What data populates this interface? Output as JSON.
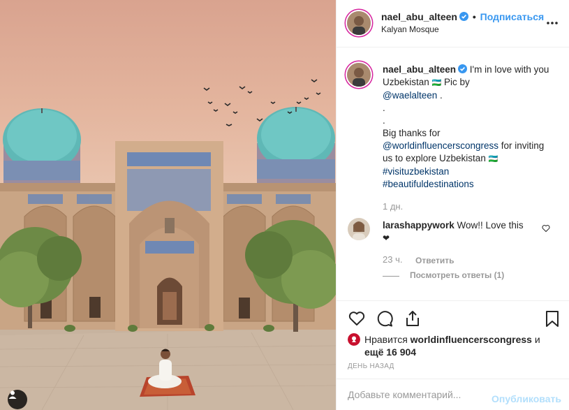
{
  "header": {
    "username": "nael_abu_alteen",
    "separator": "•",
    "follow_label": "Подписаться",
    "location": "Kalyan Mosque"
  },
  "caption": {
    "username": "nael_abu_alteen",
    "line1": " I'm in love with you Uzbekistan ",
    "line1_tail": " Pic by",
    "mention": "@waelalteen",
    "after_mention": " .",
    "dot1": ".",
    "dot2": ".",
    "thanks": "Big thanks for",
    "mention2": "@worldinfluencerscongress",
    "for_text": " for inviting us to explore Uzbekistan ",
    "hashtag1": "#visituzbekistan",
    "hashtag2": "#beautifuldestinations",
    "time": "1 дн."
  },
  "comment": {
    "username": "larashappywork",
    "text": " Wow!! Love this",
    "time": "23 ч.",
    "reply_label": "Ответить",
    "view_replies": "Посмотреть ответы (1)"
  },
  "likes": {
    "prefix": "Нравится ",
    "user": "worldinfluencerscongress",
    "and": " и ",
    "more": "ещё 16 904"
  },
  "date_label": "ДЕНЬ НАЗАД",
  "add_comment": {
    "placeholder": "Добавьте комментарий...",
    "post_label": "Опубликовать"
  },
  "icons": {
    "verified": "verified-badge-icon",
    "more": "more-options-icon",
    "heart": "heart-icon",
    "comment": "comment-icon",
    "share": "share-icon",
    "bookmark": "bookmark-icon",
    "tag": "user-tag-icon"
  },
  "colors": {
    "link": "#3897f0",
    "hashtag": "#003569",
    "muted": "#999999",
    "post_disabled": "#b2dffc"
  }
}
